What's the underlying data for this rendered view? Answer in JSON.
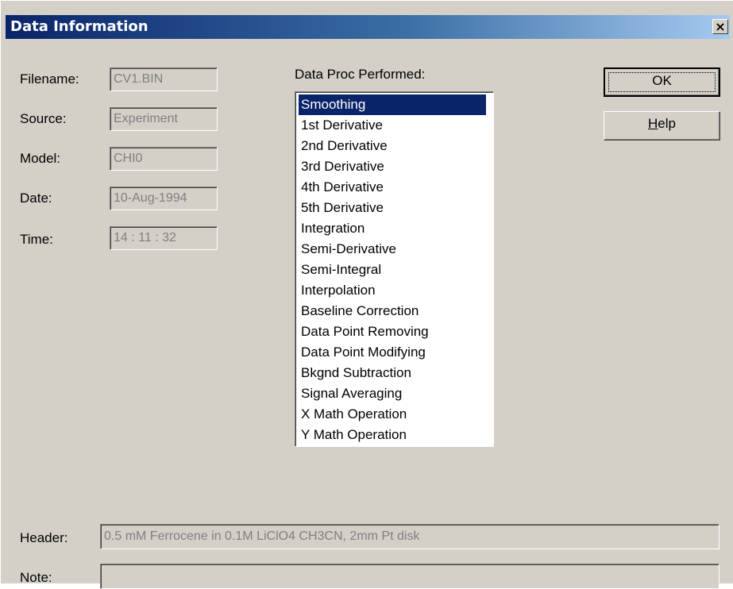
{
  "window": {
    "title": "Data Information"
  },
  "fields": {
    "filename": {
      "label": "Filename:",
      "value": "CV1.BIN"
    },
    "source": {
      "label": "Source:",
      "value": "Experiment"
    },
    "model": {
      "label": "Model:",
      "value": "CHI0"
    },
    "date": {
      "label": "Date:",
      "value": "10-Aug-1994"
    },
    "time": {
      "label": "Time:",
      "value": "14 : 11 : 32"
    },
    "header": {
      "label": "Header:",
      "value": "0.5 mM Ferrocene in 0.1M LiClO4 CH3CN, 2mm Pt disk"
    },
    "note": {
      "label": "Note:",
      "value": ""
    }
  },
  "data_proc": {
    "label": "Data Proc Performed:",
    "selected_index": 0,
    "items": [
      "Smoothing",
      "1st Derivative",
      "2nd Derivative",
      "3rd Derivative",
      "4th Derivative",
      "5th Derivative",
      "Integration",
      "Semi-Derivative",
      "Semi-Integral",
      "Interpolation",
      "Baseline Correction",
      "Data Point Removing",
      "Data Point Modifying",
      "Bkgnd Subtraction",
      "Signal Averaging",
      "X Math Operation",
      "Y Math Operation"
    ]
  },
  "buttons": {
    "ok": "OK",
    "help_first": "H",
    "help_rest": "elp",
    "close": "×"
  }
}
